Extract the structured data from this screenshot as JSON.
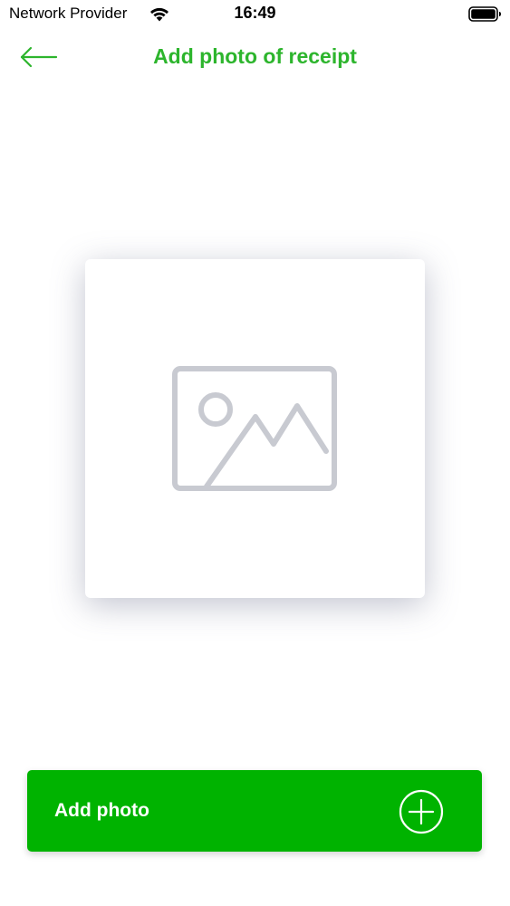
{
  "status_bar": {
    "carrier": "Network Provider",
    "time": "16:49",
    "icons": [
      "wifi-icon",
      "battery-icon"
    ]
  },
  "header": {
    "title": "Add photo of receipt",
    "back_icon": "arrow-left-icon"
  },
  "photo_card": {
    "icon": "image-placeholder-icon"
  },
  "add_photo_button": {
    "label": "Add photo",
    "icon": "plus-circle-icon"
  },
  "colors": {
    "accent": "#2db52d",
    "button": "#00b300",
    "placeholder_icon": "#c8cad1"
  }
}
